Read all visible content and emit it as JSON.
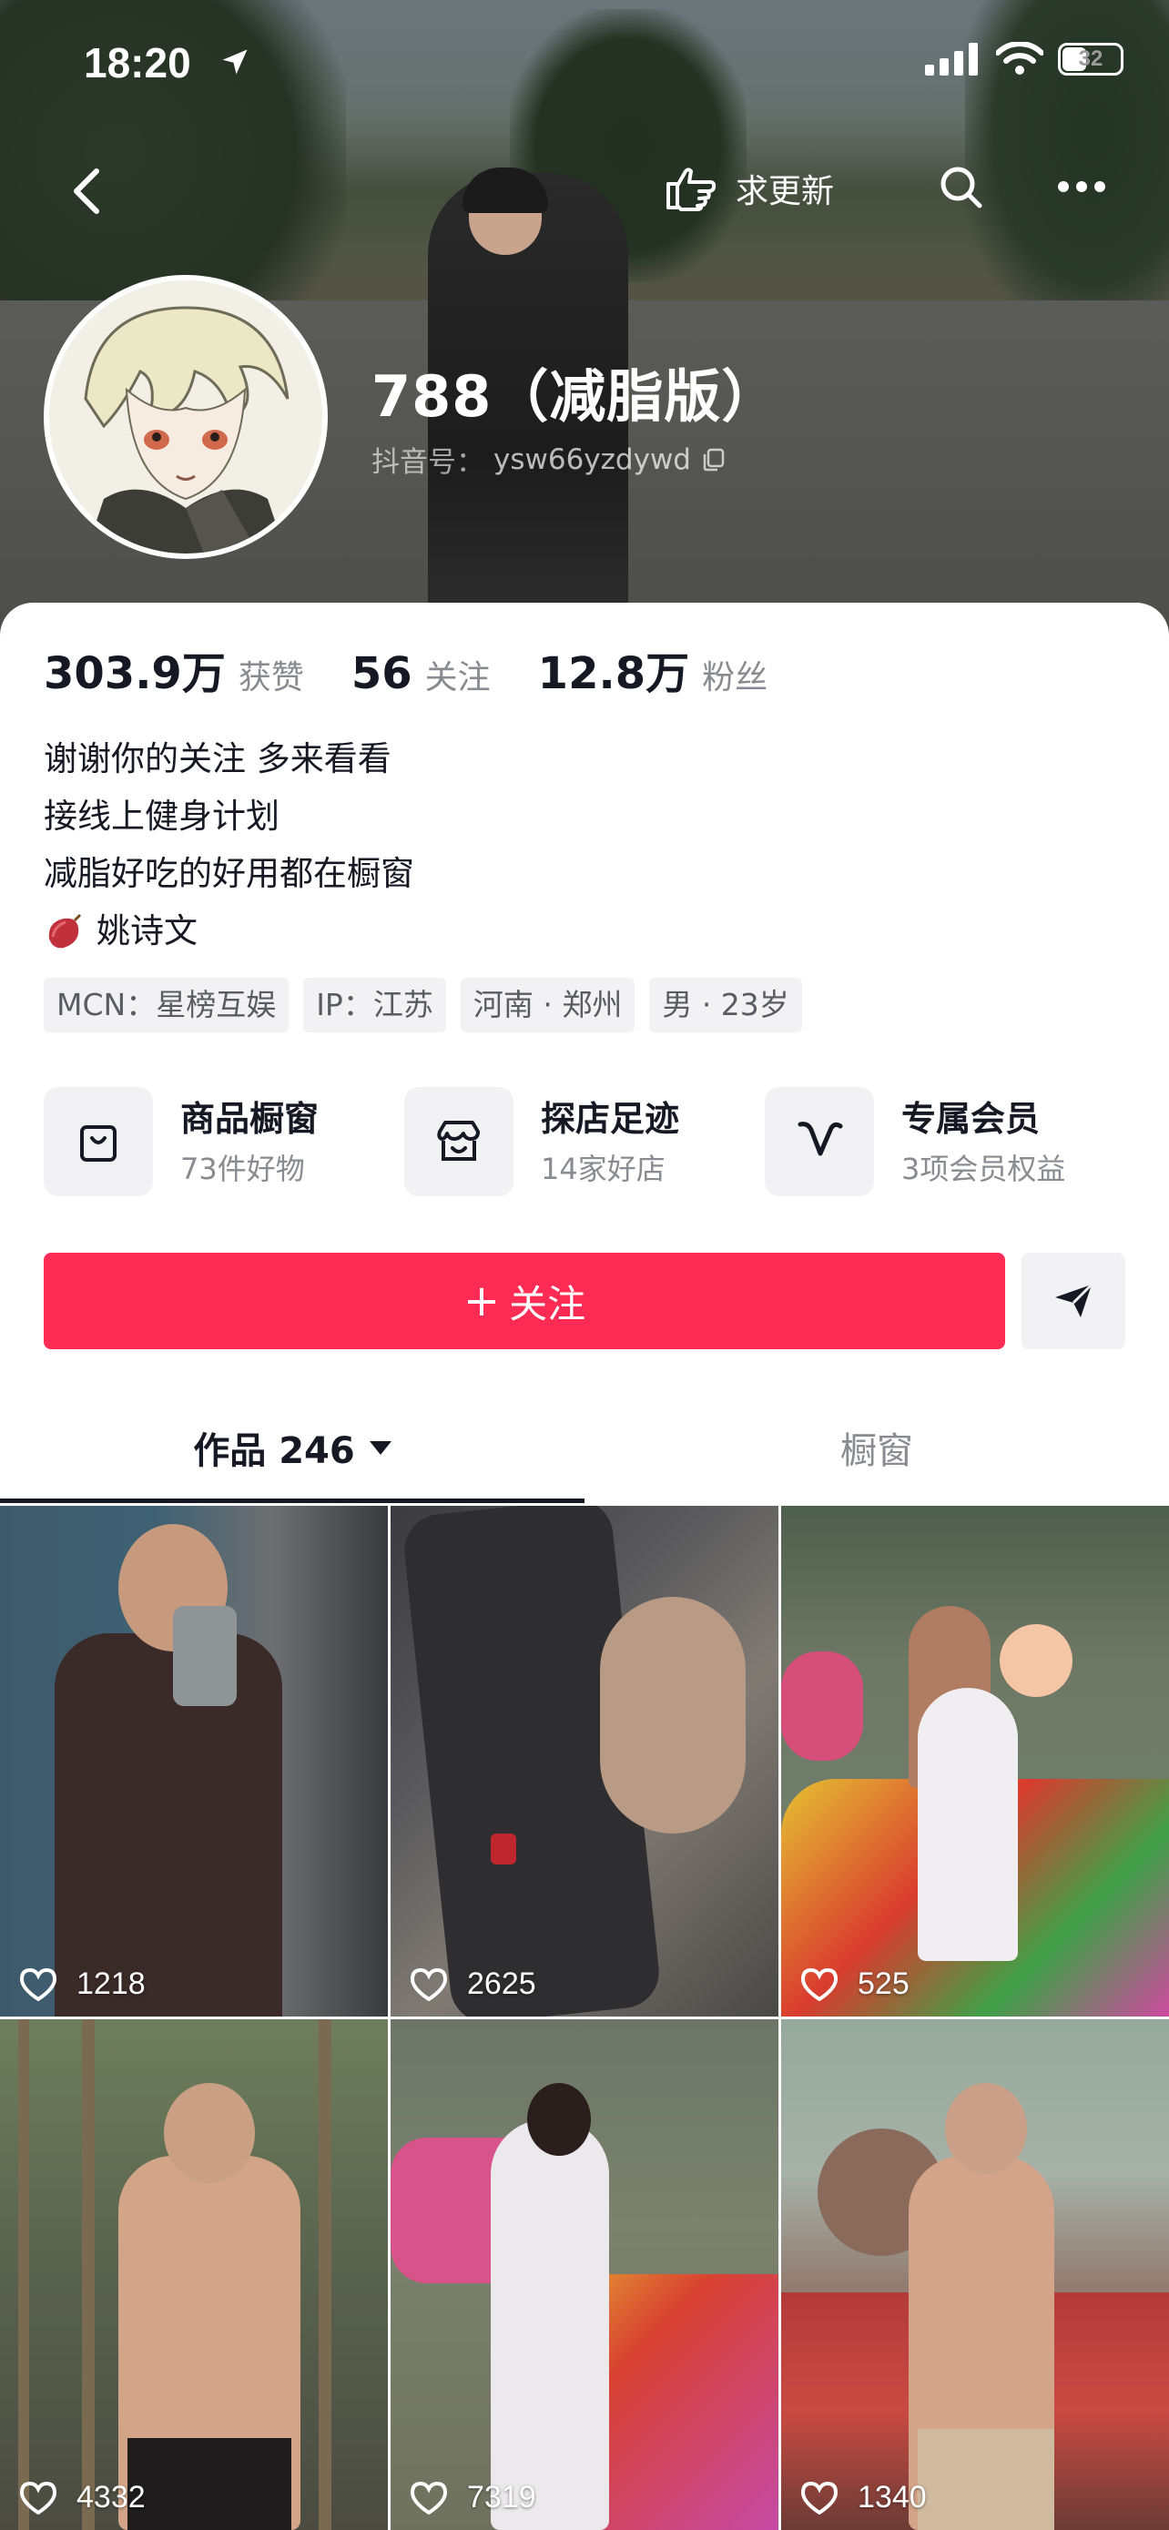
{
  "status_bar": {
    "time": "18:20",
    "battery": "32"
  },
  "nav": {
    "update_label": "求更新"
  },
  "profile": {
    "name": "788（减脂版）",
    "douyin_id_label": "抖音号：",
    "douyin_id": "ysw66yzdywd"
  },
  "stats": [
    {
      "num": "303.9万",
      "label": "获赞"
    },
    {
      "num": "56",
      "label": "关注"
    },
    {
      "num": "12.8万",
      "label": "粉丝"
    }
  ],
  "bio": {
    "line1": "谢谢你的关注 多来看看",
    "line2": "接线上健身计划",
    "line3": "减脂好吃的好用都在橱窗",
    "line4": "姚诗文"
  },
  "tags": [
    "MCN：星榜互娱",
    "IP：江苏",
    "河南 · 郑州",
    "男 · 23岁"
  ],
  "features": [
    {
      "title": "商品橱窗",
      "sub": "73件好物",
      "icon": "shopping-bag-icon"
    },
    {
      "title": "探店足迹",
      "sub": "14家好店",
      "icon": "store-icon"
    },
    {
      "title": "专属会员",
      "sub": "3项会员权益",
      "icon": "vip-v-icon"
    }
  ],
  "follow_label": "关注",
  "tabs": {
    "works": "作品 246",
    "window": "橱窗"
  },
  "videos": [
    {
      "likes": "1218"
    },
    {
      "likes": "2625"
    },
    {
      "likes": "525"
    },
    {
      "likes": "4332"
    },
    {
      "likes": "7319"
    },
    {
      "likes": "1340"
    }
  ],
  "colors": {
    "accent": "#fe2c55",
    "text": "#161823",
    "secondary": "#8a8b91",
    "chip_bg": "#f2f2f4"
  }
}
